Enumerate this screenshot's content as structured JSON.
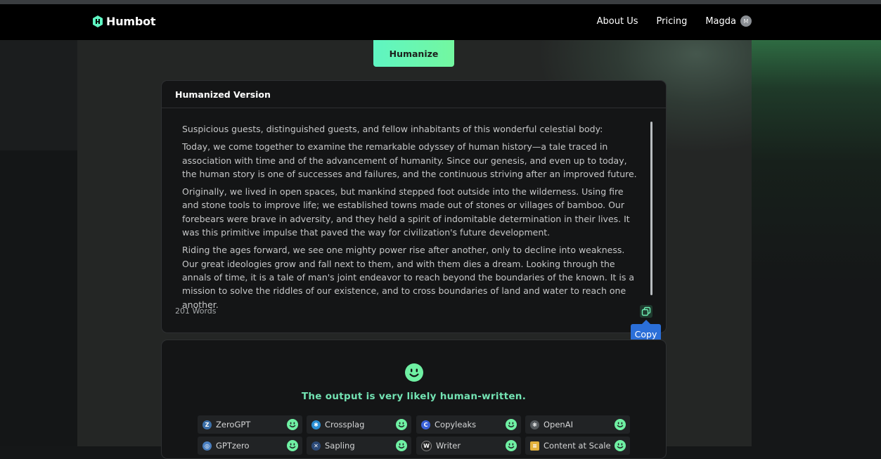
{
  "app": {
    "logo_text": "Humbot",
    "brand_color": "#5ff5c2"
  },
  "nav": {
    "links": [
      "About Us",
      "Pricing"
    ],
    "user_name": "Magda",
    "avatar_letter": "M"
  },
  "humanize_button": "Humanize",
  "output": {
    "title": "Humanized Version",
    "paragraphs": [
      "Suspicious guests, distinguished guests, and fellow inhabitants of this wonderful celestial body:",
      "Today, we come together to examine the remarkable odyssey of human history—a tale traced in association with time and of the advancement of humanity. Since our genesis, and even up to today, the human story is one of successes and failures, and the continuous striving after an improved future.",
      "Originally, we lived in open spaces, but mankind stepped foot outside into the wilderness. Using fire and stone tools to improve life; we established towns made out of stones or villages of bamboo. Our forebears were brave in adversity, and they held a spirit of indomitable determination in their lives. It was this primitive impulse that paved the way for civilization's future development.",
      "Riding the ages forward, we see one mighty power rise after another, only to decline into weakness. Our great ideologies grow and fall next to them, and with them dies a dream. Looking through the annals of time, it is a tale of man's joint endeavor to reach beyond the boundaries of the known. It is a mission to solve the riddles of our existence, and to cross boundaries of land and water to reach one another."
    ],
    "word_count": "201 Words",
    "copy_tooltip": "Copy"
  },
  "detection": {
    "result": "The output is very likely human-written.",
    "detectors": [
      {
        "name": "ZeroGPT",
        "icon": "zerogpt-icon",
        "color": "#3b6fa8"
      },
      {
        "name": "Crossplag",
        "icon": "crossplag-icon",
        "color": "#2a8fd4"
      },
      {
        "name": "Copyleaks",
        "icon": "copyleaks-icon",
        "color": "#3a62d8"
      },
      {
        "name": "OpenAI",
        "icon": "openai-icon",
        "color": "#555a5e"
      },
      {
        "name": "GPTzero",
        "icon": "gptzero-icon",
        "color": "#4a7fc0"
      },
      {
        "name": "Sapling",
        "icon": "sapling-icon",
        "color": "#2c4a78"
      },
      {
        "name": "Writer",
        "icon": "writer-icon",
        "color": "#222"
      },
      {
        "name": "Content at Scale",
        "icon": "contentatscale-icon",
        "color": "#e3b23c"
      }
    ]
  }
}
